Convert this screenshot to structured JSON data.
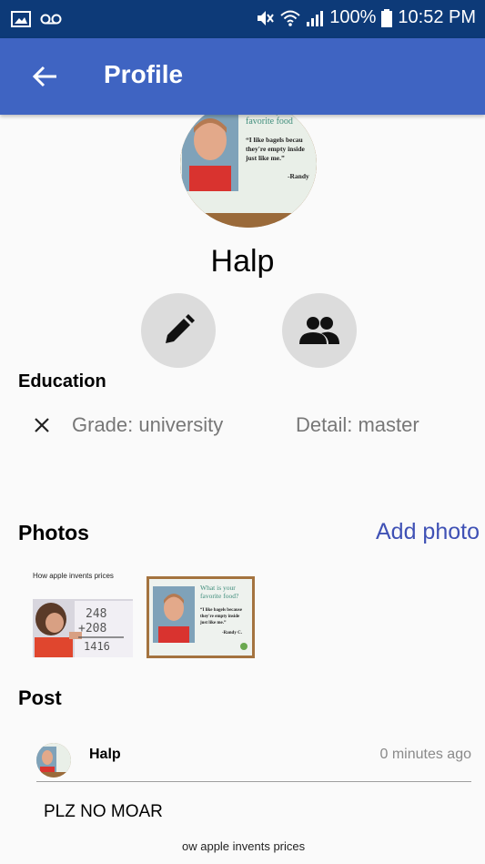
{
  "status_bar": {
    "battery": "100%",
    "time": "10:52 PM"
  },
  "app_bar": {
    "title": "Profile"
  },
  "profile": {
    "name": "Halp",
    "avatar_text": {
      "headline": "What is your favorite food?",
      "quote": "“I like bagels because they're empty inside just like me.”",
      "author": "-Randy"
    }
  },
  "education": {
    "heading": "Education",
    "grade": "Grade: university",
    "detail": "Detail: master"
  },
  "photos": {
    "heading": "Photos",
    "add_label": "Add photo",
    "items": [
      {
        "caption": "How apple invents prices",
        "board_lines": [
          "248",
          "+208",
          "1416"
        ]
      },
      {
        "headline": "What is your favorite food?",
        "quote": "“I like bagels because they're empty inside just like me.”",
        "author": "-Randy C."
      }
    ]
  },
  "post": {
    "heading": "Post",
    "author": "Halp",
    "time": "0 minutes ago",
    "text": "PLZ NO MOAR",
    "caption_partial": "ow apple invents prices"
  },
  "colors": {
    "status_bar": "#0d3a78",
    "app_bar": "#3f64c2",
    "accent": "#3f51b5"
  }
}
